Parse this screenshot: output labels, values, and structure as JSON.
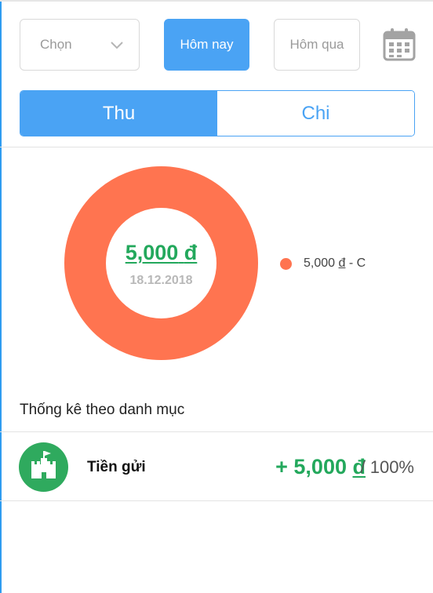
{
  "filters": {
    "pick_label": "Chọn",
    "today_label": "Hôm nay",
    "yesterday_label": "Hôm qua"
  },
  "tabs": [
    {
      "label": "Thu",
      "active": true
    },
    {
      "label": "Chi",
      "active": false
    }
  ],
  "summary": {
    "total_amount": "5,000",
    "currency": "đ",
    "date": "18.12.2018"
  },
  "chart_data": {
    "type": "pie",
    "donut": true,
    "slices": [
      {
        "label": "5,000 đ - C",
        "value": 5000,
        "color": "#ff7450"
      }
    ]
  },
  "legend": [
    {
      "amount": "5,000",
      "currency": "đ",
      "suffix": " - C",
      "color": "#ff7450"
    }
  ],
  "stats": {
    "title": "Thống kê theo danh mục",
    "items": [
      {
        "name": "Tiền gửi",
        "sign": "+ ",
        "amount": "5,000",
        "currency": "đ",
        "percent": " / 100%",
        "icon": "castle-flag-icon",
        "icon_color": "#2faa5e"
      }
    ]
  },
  "colors": {
    "accent": "#4aa3f4",
    "income_green": "#23a85c",
    "slice": "#ff7450"
  }
}
